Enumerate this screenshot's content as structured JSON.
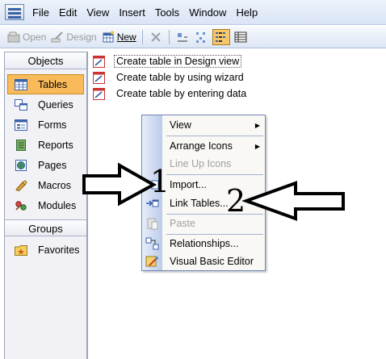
{
  "menubar": {
    "items": [
      "File",
      "Edit",
      "View",
      "Insert",
      "Tools",
      "Window",
      "Help"
    ]
  },
  "toolbar": {
    "open_label": "Open",
    "design_label": "Design",
    "new_label": "New"
  },
  "objects_pane": {
    "objects_header": "Objects",
    "items": [
      {
        "label": "Tables",
        "icon": "table-icon",
        "selected": true
      },
      {
        "label": "Queries",
        "icon": "query-icon"
      },
      {
        "label": "Forms",
        "icon": "form-icon"
      },
      {
        "label": "Reports",
        "icon": "report-icon"
      },
      {
        "label": "Pages",
        "icon": "page-icon"
      },
      {
        "label": "Macros",
        "icon": "macro-icon"
      },
      {
        "label": "Modules",
        "icon": "module-icon"
      }
    ],
    "groups_header": "Groups",
    "groups": [
      {
        "label": "Favorites",
        "icon": "favorites-folder-icon"
      }
    ]
  },
  "main_list": [
    "Create table in Design view",
    "Create table by using wizard",
    "Create table by entering data"
  ],
  "context_menu": {
    "items": [
      {
        "label": "View",
        "submenu": true
      },
      {
        "label": "Arrange Icons",
        "submenu": true
      },
      {
        "label": "Line Up Icons",
        "disabled": true
      },
      {
        "label": "Import...",
        "icon": "import-icon"
      },
      {
        "label": "Link Tables...",
        "icon": "link-tables-icon"
      },
      {
        "label": "Paste",
        "disabled": true,
        "icon": "paste-icon"
      },
      {
        "label": "Relationships...",
        "icon": "relationships-icon"
      },
      {
        "label": "Visual Basic Editor",
        "icon": "vb-editor-icon"
      }
    ]
  },
  "annotations": {
    "label_1": "1",
    "label_2": "2"
  },
  "colors": {
    "selected_bg": "#f9bb5a",
    "menu_gradient_end": "#bccbe9"
  }
}
